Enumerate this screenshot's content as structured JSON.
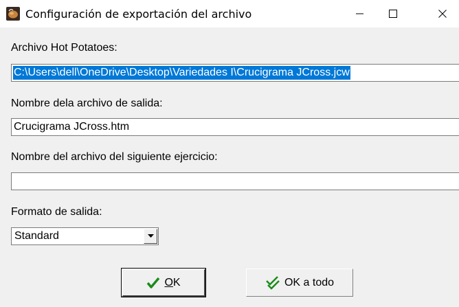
{
  "window": {
    "title": "Configuración de exportación del archivo",
    "icon": "hot-potatoes-app-icon"
  },
  "fields": {
    "source_label": "Archivo Hot Potatoes:",
    "source_value": "C:\\Users\\dell\\OneDrive\\Desktop\\Variedades I\\Crucigrama JCross.jcw",
    "output_label": "Nombre dela archivo de salida:",
    "output_value": "Crucigrama JCross.htm",
    "next_label": "Nombre del archivo del siguiente ejercicio:",
    "next_value": "",
    "format_label": "Formato de salida:",
    "format_value": "Standard"
  },
  "buttons": {
    "ok_label_rest": "K",
    "ok_label_mnemonic": "O",
    "ok_all_label": "OK a todo"
  },
  "colors": {
    "selection": "#0078d7",
    "check_green": "#1a8c1a"
  }
}
